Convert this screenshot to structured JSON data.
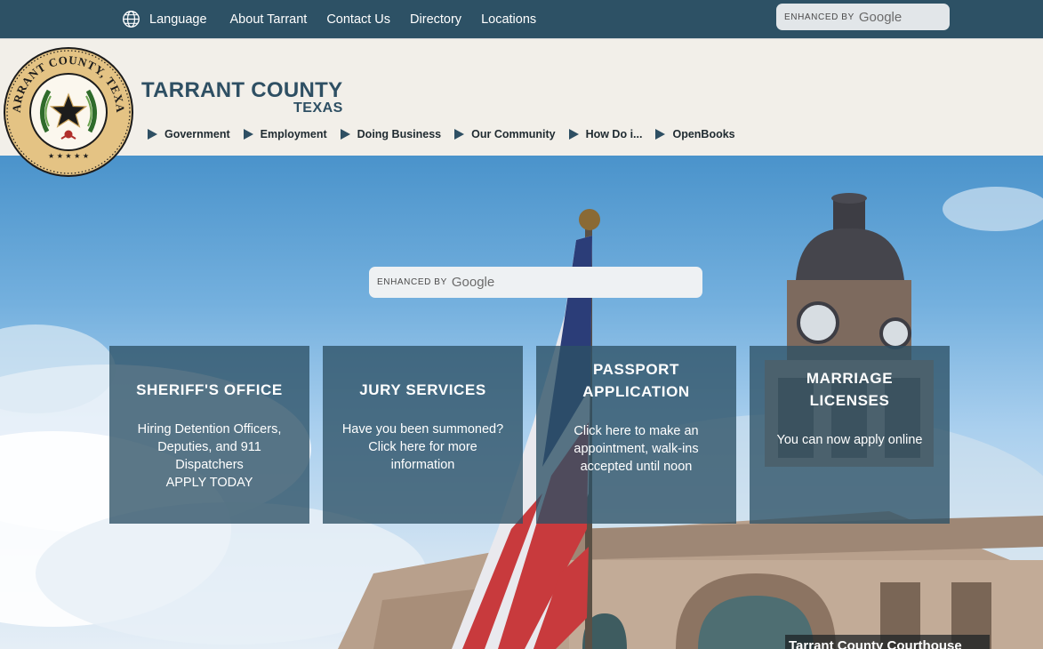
{
  "topbar": {
    "language": "Language",
    "links": [
      "About Tarrant",
      "Contact Us",
      "Directory",
      "Locations"
    ],
    "search": {
      "enhanced_by": "ENHANCED BY",
      "google": "Google"
    }
  },
  "header": {
    "title": "TARRANT COUNTY",
    "subtitle": "TEXAS",
    "seal_text": "TARRANT COUNTY, TEXAS",
    "nav": [
      "Government",
      "Employment",
      "Doing Business",
      "Our Community",
      "How Do i...",
      "OpenBooks"
    ]
  },
  "hero": {
    "search": {
      "enhanced_by": "ENHANCED BY",
      "google": "Google"
    },
    "cards": [
      {
        "title": "SHERIFF'S OFFICE",
        "desc": "Hiring Detention Officers, Deputies, and 911 Dispatchers",
        "extra": "APPLY TODAY"
      },
      {
        "title": "JURY SERVICES",
        "desc": "Have you been summoned? Click here for more information"
      },
      {
        "title": "PASSPORT APPLICATION",
        "desc": "Click here to make an appointment, walk-ins accepted until noon"
      },
      {
        "title": "MARRIAGE LICENSES",
        "desc": "You can now apply online"
      }
    ],
    "caption": "Tarrant County Courthouse"
  },
  "colors": {
    "nav_bg": "#2d5165",
    "header_bg": "#f2efe9",
    "card_bg": "#2d5165",
    "brand": "#2e4f63"
  },
  "icons": {
    "language": "globe-icon",
    "nav_marker": "triangle-right-icon"
  }
}
